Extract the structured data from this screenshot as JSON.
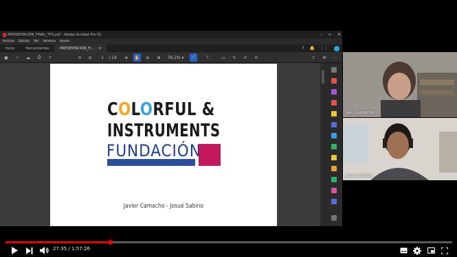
{
  "window": {
    "title": "PRESENTACIÓN_FINAL_TFG.pdf - Adobe Acrobat Pro DC",
    "controls": [
      "minimize",
      "maximize",
      "close"
    ]
  },
  "menu": [
    "Archivo",
    "Edición",
    "Ver",
    "Ventana",
    "Ayuda"
  ],
  "tabs": [
    {
      "label": "Inicio"
    },
    {
      "label": "Herramientas"
    },
    {
      "label": "PRESENTACIÓN_FI..."
    }
  ],
  "toolbar": {
    "page_current": "1",
    "page_total": "/ 14",
    "zoom": "76,1%"
  },
  "slide": {
    "line1_pre": "C",
    "line1_o1": "O",
    "line1_mid": "L",
    "line1_o2": "O",
    "line1_post": "RFUL &",
    "line2": "INSTRUMENTS",
    "fundacion": "FUNDACIÓN",
    "authors": "Javier Camacho - Josué Sabino"
  },
  "participants": [
    {
      "name": "Javi Camacho"
    },
    {
      "name": "Josue Sabino"
    }
  ],
  "player": {
    "current_time": "27:35",
    "duration": "1:57:26",
    "progress": 0.235,
    "time_display": "27:35 / 1:57:26"
  },
  "icons": {
    "play": "play-icon",
    "next": "next-icon",
    "volume": "volume-icon",
    "subtitles": "subtitles-icon",
    "settings": "gear-icon",
    "miniplayer": "miniplayer-icon",
    "fullscreen": "fullscreen-icon"
  },
  "colors": {
    "accent_red": "#e00000",
    "acrobat_blue": "#2763c6",
    "fundacion_blue": "#2e4fa0",
    "fundacion_magenta": "#c2185b"
  }
}
